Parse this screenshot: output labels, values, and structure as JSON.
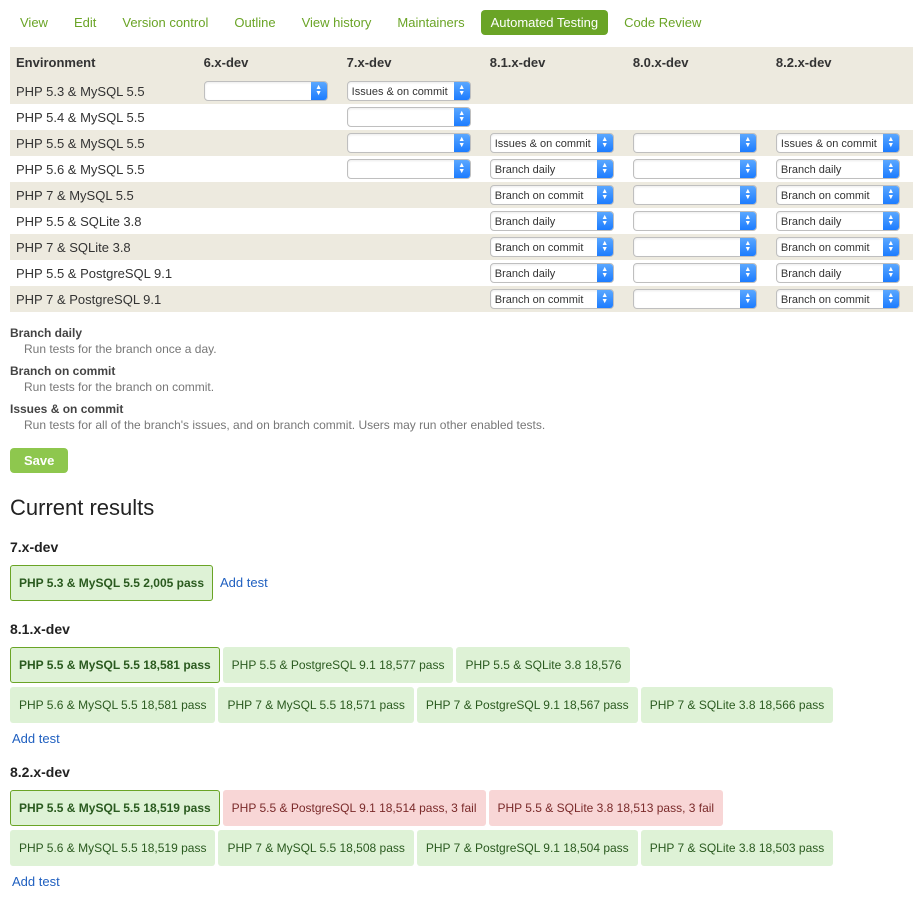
{
  "tabs": {
    "items": [
      {
        "label": "View"
      },
      {
        "label": "Edit"
      },
      {
        "label": "Version control"
      },
      {
        "label": "Outline"
      },
      {
        "label": "View history"
      },
      {
        "label": "Maintainers"
      },
      {
        "label": "Automated Testing",
        "active": true
      },
      {
        "label": "Code Review"
      }
    ]
  },
  "grid": {
    "columns": [
      "Environment",
      "6.x-dev",
      "7.x-dev",
      "8.1.x-dev",
      "8.0.x-dev",
      "8.2.x-dev"
    ],
    "rows": [
      {
        "env": "PHP 5.3 & MySQL 5.5",
        "cells": [
          "",
          "Issues & on commit",
          null,
          null,
          null
        ]
      },
      {
        "env": "PHP 5.4 & MySQL 5.5",
        "cells": [
          null,
          "",
          null,
          null,
          null
        ]
      },
      {
        "env": "PHP 5.5 & MySQL 5.5",
        "cells": [
          null,
          "",
          "Issues & on commit",
          "",
          "Issues & on commit"
        ]
      },
      {
        "env": "PHP 5.6 & MySQL 5.5",
        "cells": [
          null,
          "",
          "Branch daily",
          "",
          "Branch daily"
        ]
      },
      {
        "env": "PHP 7 & MySQL 5.5",
        "cells": [
          null,
          null,
          "Branch on commit",
          "",
          "Branch on commit"
        ]
      },
      {
        "env": "PHP 5.5 & SQLite 3.8",
        "cells": [
          null,
          null,
          "Branch daily",
          "",
          "Branch daily"
        ]
      },
      {
        "env": "PHP 7 & SQLite 3.8",
        "cells": [
          null,
          null,
          "Branch on commit",
          "",
          "Branch on commit"
        ]
      },
      {
        "env": "PHP 5.5 & PostgreSQL 9.1",
        "cells": [
          null,
          null,
          "Branch daily",
          "",
          "Branch daily"
        ]
      },
      {
        "env": "PHP 7 & PostgreSQL 9.1",
        "cells": [
          null,
          null,
          "Branch on commit",
          "",
          "Branch on commit"
        ]
      }
    ]
  },
  "definitions": [
    {
      "term": "Branch daily",
      "desc": "Run tests for the branch once a day."
    },
    {
      "term": "Branch on commit",
      "desc": "Run tests for the branch on commit."
    },
    {
      "term": "Issues & on commit",
      "desc": "Run tests for all of the branch's issues, and on branch commit. Users may run other enabled tests."
    }
  ],
  "save_label": "Save",
  "results_heading": "Current results",
  "add_test_label": "Add test",
  "results": [
    {
      "branch": "7.x-dev",
      "rows": [
        [
          {
            "label": "PHP 5.3 & MySQL 5.5 2,005 pass",
            "status": "pass",
            "primary": true
          }
        ]
      ],
      "add_inline": true
    },
    {
      "branch": "8.1.x-dev",
      "rows": [
        [
          {
            "label": "PHP 5.5 & MySQL 5.5 18,581 pass",
            "status": "pass",
            "primary": true
          },
          {
            "label": "PHP 5.5 & PostgreSQL 9.1 18,577 pass",
            "status": "pass"
          },
          {
            "label": "PHP 5.5 & SQLite 3.8 18,576",
            "status": "pass"
          }
        ],
        [
          {
            "label": "PHP 5.6 & MySQL 5.5 18,581 pass",
            "status": "pass"
          },
          {
            "label": "PHP 7 & MySQL 5.5 18,571 pass",
            "status": "pass"
          },
          {
            "label": "PHP 7 & PostgreSQL 9.1 18,567 pass",
            "status": "pass"
          },
          {
            "label": "PHP 7 & SQLite 3.8 18,566 pass",
            "status": "pass"
          }
        ]
      ],
      "add_below": true
    },
    {
      "branch": "8.2.x-dev",
      "rows": [
        [
          {
            "label": "PHP 5.5 & MySQL 5.5 18,519 pass",
            "status": "pass",
            "primary": true
          },
          {
            "label": "PHP 5.5 & PostgreSQL 9.1 18,514 pass, 3 fail",
            "status": "fail"
          },
          {
            "label": "PHP 5.5 & SQLite 3.8 18,513 pass, 3 fail",
            "status": "fail"
          }
        ],
        [
          {
            "label": "PHP 5.6 & MySQL 5.5 18,519 pass",
            "status": "pass"
          },
          {
            "label": "PHP 7 & MySQL 5.5 18,508 pass",
            "status": "pass"
          },
          {
            "label": "PHP 7 & PostgreSQL 9.1 18,504 pass",
            "status": "pass"
          },
          {
            "label": "PHP 7 & SQLite 3.8 18,503 pass",
            "status": "pass"
          }
        ]
      ],
      "add_below": true
    }
  ]
}
